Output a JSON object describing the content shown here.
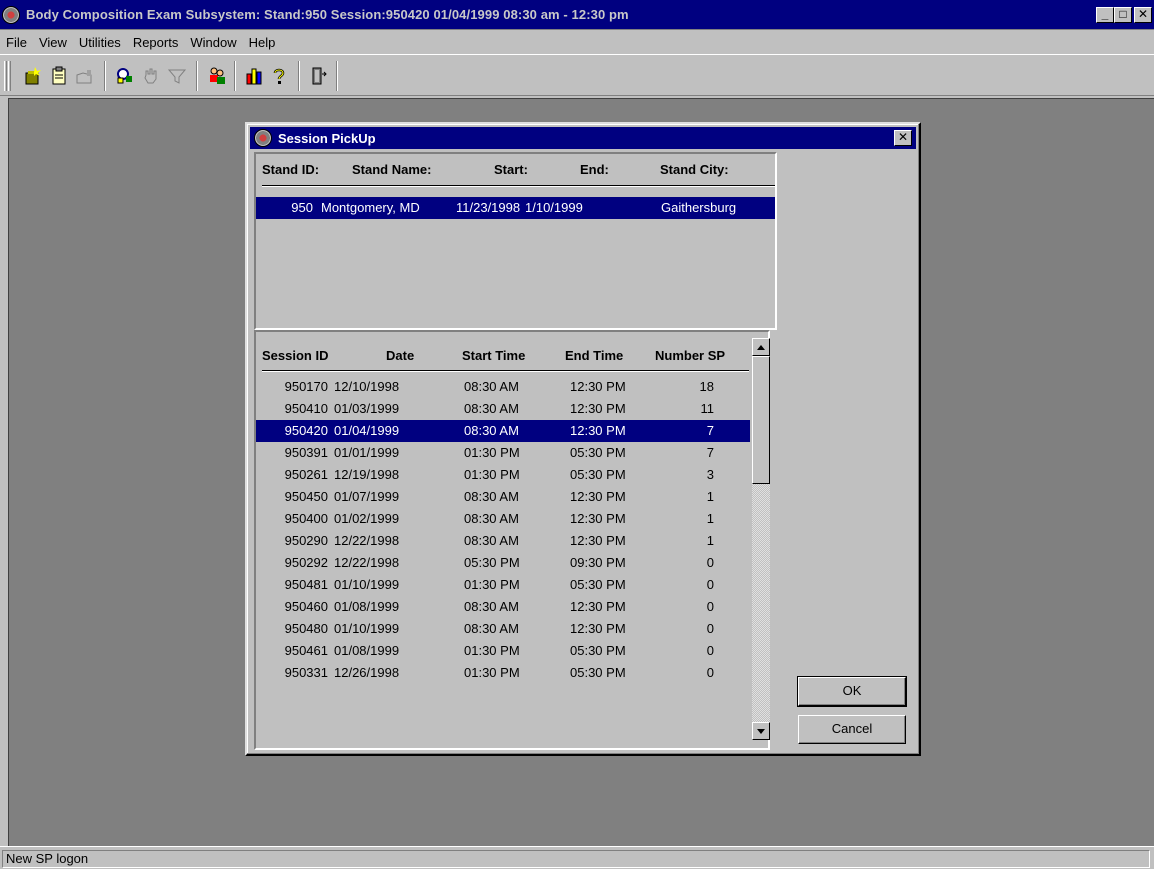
{
  "window": {
    "title": "Body Composition Exam Subsystem: Stand:950 Session:950420 01/04/1999 08:30 am - 12:30 pm",
    "minimize": "_",
    "restore": "□",
    "close": "✕"
  },
  "menu": [
    "File",
    "View",
    "Utilities",
    "Reports",
    "Window",
    "Help"
  ],
  "toolbar": {
    "icons": [
      "new-sp-icon",
      "clipboard-icon",
      "folder-icon",
      "find-icon",
      "hand-icon",
      "funnel-icon",
      "users-icon",
      "chart-icon",
      "help-icon",
      "exit-icon"
    ]
  },
  "dialog": {
    "title": "Session PickUp",
    "close": "✕",
    "stand_headers": {
      "id": "Stand ID:",
      "name": "Stand Name:",
      "start": "Start:",
      "end": "End:",
      "city": "Stand City:"
    },
    "stands": [
      {
        "id": "950",
        "name": "Montgomery, MD",
        "start": "11/23/1998",
        "end": "1/10/1999",
        "city": "Gaithersburg"
      }
    ],
    "session_headers": {
      "id": "Session ID",
      "date": "Date",
      "start": "Start Time",
      "end": "End Time",
      "number": "Number SP"
    },
    "sessions": [
      {
        "id": "950170",
        "date": "12/10/1998",
        "start": "08:30 AM",
        "end": "12:30 PM",
        "number": "18"
      },
      {
        "id": "950410",
        "date": "01/03/1999",
        "start": "08:30 AM",
        "end": "12:30 PM",
        "number": "11"
      },
      {
        "id": "950420",
        "date": "01/04/1999",
        "start": "08:30 AM",
        "end": "12:30 PM",
        "number": "7"
      },
      {
        "id": "950391",
        "date": "01/01/1999",
        "start": "01:30 PM",
        "end": "05:30 PM",
        "number": "7"
      },
      {
        "id": "950261",
        "date": "12/19/1998",
        "start": "01:30 PM",
        "end": "05:30 PM",
        "number": "3"
      },
      {
        "id": "950450",
        "date": "01/07/1999",
        "start": "08:30 AM",
        "end": "12:30 PM",
        "number": "1"
      },
      {
        "id": "950400",
        "date": "01/02/1999",
        "start": "08:30 AM",
        "end": "12:30 PM",
        "number": "1"
      },
      {
        "id": "950290",
        "date": "12/22/1998",
        "start": "08:30 AM",
        "end": "12:30 PM",
        "number": "1"
      },
      {
        "id": "950292",
        "date": "12/22/1998",
        "start": "05:30 PM",
        "end": "09:30 PM",
        "number": "0"
      },
      {
        "id": "950481",
        "date": "01/10/1999",
        "start": "01:30 PM",
        "end": "05:30 PM",
        "number": "0"
      },
      {
        "id": "950460",
        "date": "01/08/1999",
        "start": "08:30 AM",
        "end": "12:30 PM",
        "number": "0"
      },
      {
        "id": "950480",
        "date": "01/10/1999",
        "start": "08:30 AM",
        "end": "12:30 PM",
        "number": "0"
      },
      {
        "id": "950461",
        "date": "01/08/1999",
        "start": "01:30 PM",
        "end": "05:30 PM",
        "number": "0"
      },
      {
        "id": "950331",
        "date": "12/26/1998",
        "start": "01:30 PM",
        "end": "05:30 PM",
        "number": "0"
      }
    ],
    "ok_label": "OK",
    "cancel_label": "Cancel"
  },
  "status": {
    "text": "New SP logon"
  },
  "colors": {
    "title_bar": "#000080",
    "selection": "#000080",
    "face": "#c0c0c0",
    "workspace": "#808080"
  }
}
